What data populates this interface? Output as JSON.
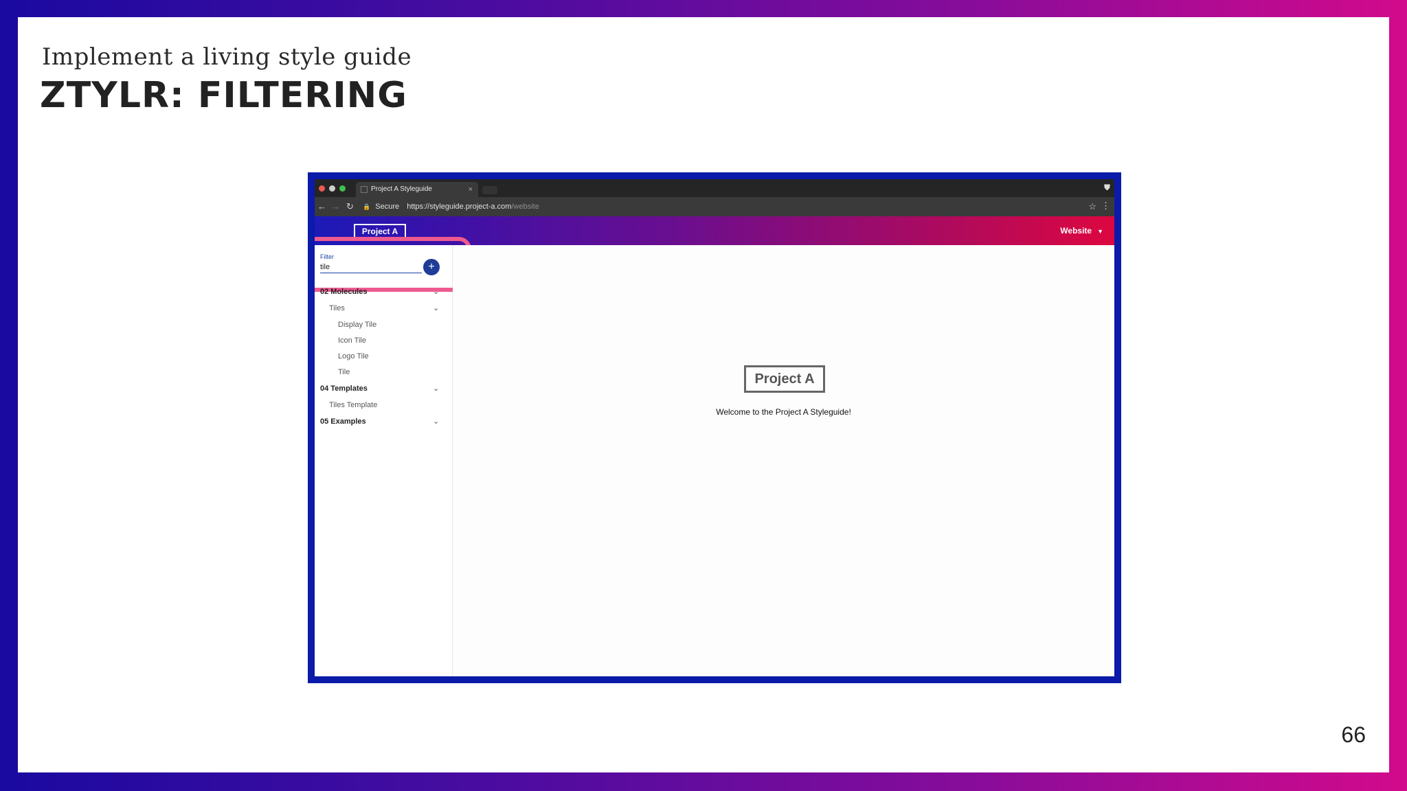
{
  "slide": {
    "subtitle": "Implement a living style guide",
    "title": "ZTYLR: FILTERING",
    "page_number": "66"
  },
  "browser": {
    "tab_title": "Project A Styleguide",
    "tab_close": "×",
    "url_secure": "Secure",
    "url_base": "https://styleguide.project-a.com",
    "url_path": "/website"
  },
  "app": {
    "logo_text": "Project A",
    "menu_label": "Website",
    "filter": {
      "label": "Filter",
      "value": "tile"
    },
    "add_button": "+",
    "nav": {
      "molecules": "02 Molecules",
      "tiles": "Tiles",
      "display_tile": "Display Tile",
      "icon_tile": "Icon Tile",
      "logo_tile": "Logo Tile",
      "tile": "Tile",
      "templates": "04 Templates",
      "tiles_template": "Tiles Template",
      "examples": "05 Examples"
    },
    "main": {
      "logo_text": "Project A",
      "welcome": "Welcome to the Project A Styleguide!"
    }
  },
  "colors": {
    "frame": "#0b1aa8",
    "accent_blue": "#1a3fa8",
    "highlight": "#ee5a8f"
  },
  "icons": {
    "back": "arrow-left-icon",
    "forward": "arrow-right-icon",
    "reload": "reload-icon",
    "lock": "lock-icon",
    "star": "star-icon",
    "menu": "kebab-icon",
    "chevron": "chevron-down-icon",
    "add": "plus-icon"
  }
}
